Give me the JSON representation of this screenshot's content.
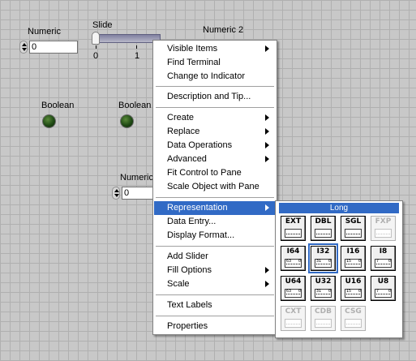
{
  "panel": {
    "numeric1": {
      "label": "Numeric",
      "value": "0"
    },
    "slide": {
      "label": "Slide",
      "scale": [
        "0",
        "1"
      ]
    },
    "numeric2": {
      "label": "Numeric 2"
    },
    "boolean1": {
      "label": "Boolean"
    },
    "boolean2": {
      "label": "Boolean"
    },
    "numeric3": {
      "label": "Numeric",
      "value": "0"
    }
  },
  "menu": {
    "items": [
      {
        "label": "Visible Items",
        "submenu": true
      },
      {
        "label": "Find Terminal",
        "submenu": false
      },
      {
        "label": "Change to Indicator",
        "submenu": false
      },
      {
        "label": "Description and Tip...",
        "submenu": false
      },
      {
        "label": "Create",
        "submenu": true
      },
      {
        "label": "Replace",
        "submenu": true
      },
      {
        "label": "Data Operations",
        "submenu": true
      },
      {
        "label": "Advanced",
        "submenu": true
      },
      {
        "label": "Fit Control to Pane",
        "submenu": false
      },
      {
        "label": "Scale Object with Pane",
        "submenu": false
      },
      {
        "label": "Representation",
        "submenu": true,
        "highlighted": true
      },
      {
        "label": "Data Entry...",
        "submenu": false
      },
      {
        "label": "Display Format...",
        "submenu": false
      },
      {
        "label": "Add Slider",
        "submenu": false
      },
      {
        "label": "Fill Options",
        "submenu": true
      },
      {
        "label": "Scale",
        "submenu": true
      },
      {
        "label": "Text Labels",
        "submenu": false
      },
      {
        "label": "Properties",
        "submenu": false
      }
    ]
  },
  "representation": {
    "title": "Long",
    "types": [
      {
        "code": "EXT",
        "bits": [
          "",
          ""
        ],
        "enabled": true,
        "selected": false
      },
      {
        "code": "DBL",
        "bits": [
          "",
          ""
        ],
        "enabled": true,
        "selected": false
      },
      {
        "code": "SGL",
        "bits": [
          "",
          ""
        ],
        "enabled": true,
        "selected": false
      },
      {
        "code": "FXP",
        "bits": [
          "",
          ""
        ],
        "enabled": false,
        "selected": false
      },
      {
        "code": "I64",
        "bits": [
          "63",
          "0"
        ],
        "enabled": true,
        "selected": false
      },
      {
        "code": "I32",
        "bits": [
          "31",
          "0"
        ],
        "enabled": true,
        "selected": true
      },
      {
        "code": "I16",
        "bits": [
          "15",
          "0"
        ],
        "enabled": true,
        "selected": false
      },
      {
        "code": "I8",
        "bits": [
          "7",
          "0"
        ],
        "enabled": true,
        "selected": false
      },
      {
        "code": "U64",
        "bits": [
          "63",
          "0"
        ],
        "enabled": true,
        "selected": false
      },
      {
        "code": "U32",
        "bits": [
          "31",
          "0"
        ],
        "enabled": true,
        "selected": false
      },
      {
        "code": "U16",
        "bits": [
          "15",
          "0"
        ],
        "enabled": true,
        "selected": false
      },
      {
        "code": "U8",
        "bits": [
          "7",
          "0"
        ],
        "enabled": true,
        "selected": false
      },
      {
        "code": "CXT",
        "bits": [
          "",
          ""
        ],
        "enabled": false,
        "selected": false
      },
      {
        "code": "CDB",
        "bits": [
          "",
          ""
        ],
        "enabled": false,
        "selected": false
      },
      {
        "code": "CSG",
        "bits": [
          "",
          ""
        ],
        "enabled": false,
        "selected": false
      }
    ]
  },
  "colors": {
    "highlight": "#316ac5",
    "led_off": "#1f4a14",
    "panel_bg": "#c8c8c8"
  }
}
